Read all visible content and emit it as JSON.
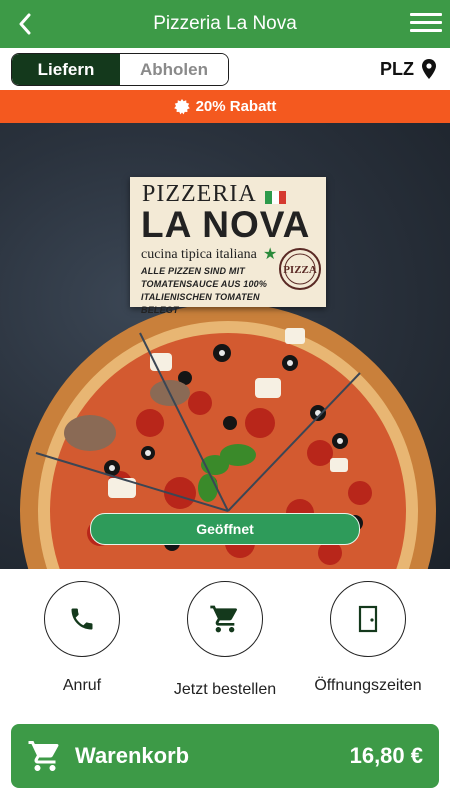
{
  "header": {
    "title": "Pizzeria La Nova",
    "back_icon": "chevron-left-icon",
    "menu_icon": "hamburger-menu-icon"
  },
  "mode_toggle": {
    "options": [
      "Liefern",
      "Abholen"
    ],
    "selected": "Liefern"
  },
  "postcode": {
    "label": "PLZ",
    "icon": "map-pin-icon"
  },
  "promo": {
    "text": "20% Rabatt",
    "icon": "badge-icon",
    "color": "#f4591f"
  },
  "logo": {
    "line1": "PIZZERIA",
    "line2": "LA NOVA",
    "line3": "cucina tipica italiana",
    "line4": "ALLE PIZZEN SIND MIT TOMATENSAUCE AUS 100% ITALIENISCHEN TOMATEN BELEGT",
    "seal_text": "PIZZA"
  },
  "status": {
    "label": "Geöffnet"
  },
  "actions": [
    {
      "label": "Anruf",
      "icon": "phone-icon"
    },
    {
      "label": "Jetzt bestellen",
      "icon": "shopping-cart-icon"
    },
    {
      "label": "Öffnungszeiten",
      "icon": "door-icon"
    }
  ],
  "cart": {
    "label": "Warenkorb",
    "total": "16,80 €",
    "icon": "shopping-cart-icon"
  },
  "colors": {
    "primary": "#3d9a47",
    "dark_green": "#14391c",
    "open_green": "#2e9b5a"
  }
}
